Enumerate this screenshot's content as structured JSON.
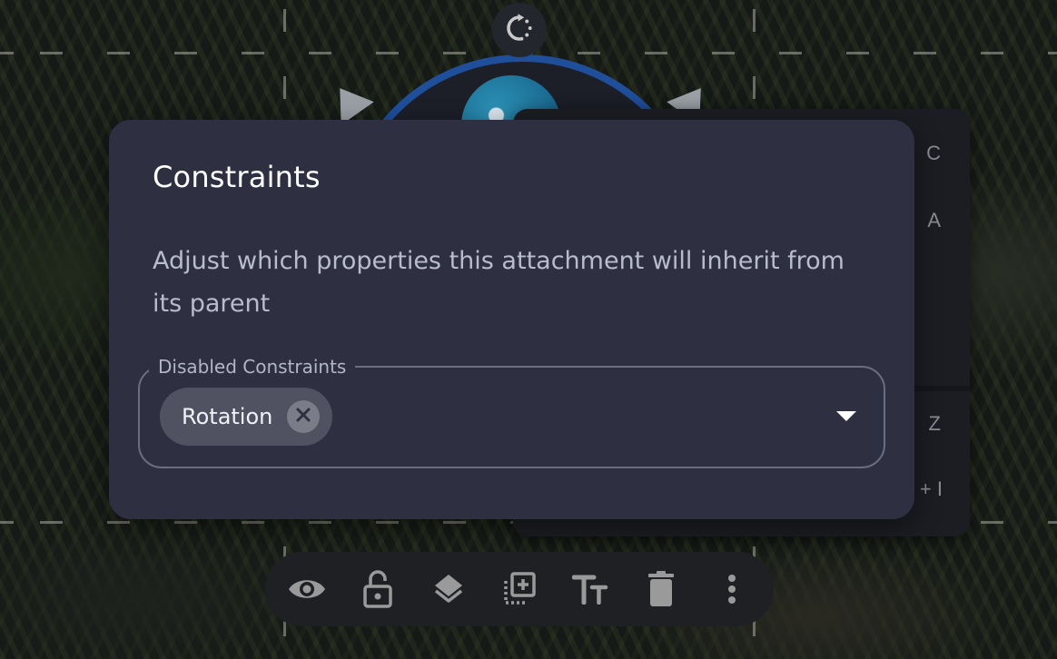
{
  "dialog": {
    "title": "Constraints",
    "description": "Adjust which properties this attachment will inherit from its parent",
    "field": {
      "label": "Disabled Constraints",
      "selected_chips": [
        {
          "label": "Rotation",
          "remove_icon": "close-circle-icon"
        }
      ],
      "dropdown_icon": "caret-down-icon"
    }
  },
  "context_menu": {
    "partial_shortcuts": [
      "C",
      "A",
      "Z",
      "+ I"
    ]
  },
  "rotate_handle": {
    "icon": "rotate-icon"
  },
  "toolbar": {
    "buttons": [
      {
        "name": "visibility",
        "icon": "eye-icon"
      },
      {
        "name": "lock",
        "icon": "unlock-icon"
      },
      {
        "name": "layers",
        "icon": "layers-icon"
      },
      {
        "name": "add-attachment",
        "icon": "add-to-photos-icon"
      },
      {
        "name": "text",
        "icon": "text-size-icon"
      },
      {
        "name": "delete",
        "icon": "trash-icon"
      },
      {
        "name": "more",
        "icon": "more-vertical-icon"
      }
    ]
  },
  "colors": {
    "dialog_bg": "#2e3042",
    "chip_bg": "#505262",
    "token_ring": "#1f4e9a",
    "toolbar_bg": "#1e2024",
    "icon_gray": "#9a9a9a"
  }
}
